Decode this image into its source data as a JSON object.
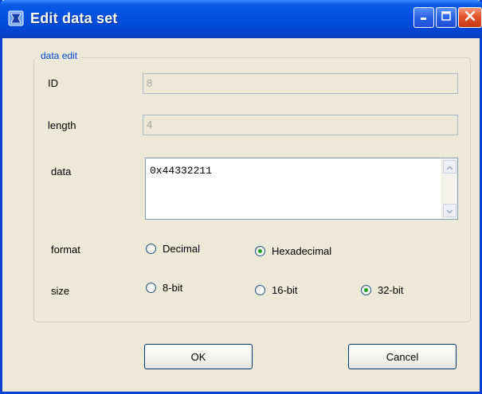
{
  "window": {
    "title": "Edit data set",
    "controls": {
      "minimize": "minimize",
      "maximize": "maximize",
      "close": "close"
    }
  },
  "group": {
    "legend": "data edit"
  },
  "fields": {
    "id": {
      "label": "ID",
      "value": "8"
    },
    "length": {
      "label": "length",
      "value": "4"
    },
    "data": {
      "label": "data",
      "value": "0x44332211"
    }
  },
  "format": {
    "label": "format",
    "options": [
      {
        "label": "Decimal",
        "checked": false
      },
      {
        "label": "Hexadecimal",
        "checked": true
      }
    ]
  },
  "size": {
    "label": "size",
    "options": [
      {
        "label": "8-bit",
        "checked": false
      },
      {
        "label": "16-bit",
        "checked": false
      },
      {
        "label": "32-bit",
        "checked": true
      }
    ]
  },
  "buttons": {
    "ok": "OK",
    "cancel": "Cancel"
  },
  "colors": {
    "titlebar": "#0350e0",
    "window_bg": "#ece9d8",
    "legend": "#0046d5",
    "radio_dot": "#21a121",
    "close": "#e2542c"
  },
  "icons": {
    "app": "app-icon",
    "minimize": "minimize-icon",
    "maximize": "maximize-icon",
    "close": "close-icon",
    "scroll_up": "scroll-up-icon",
    "scroll_down": "scroll-down-icon"
  }
}
